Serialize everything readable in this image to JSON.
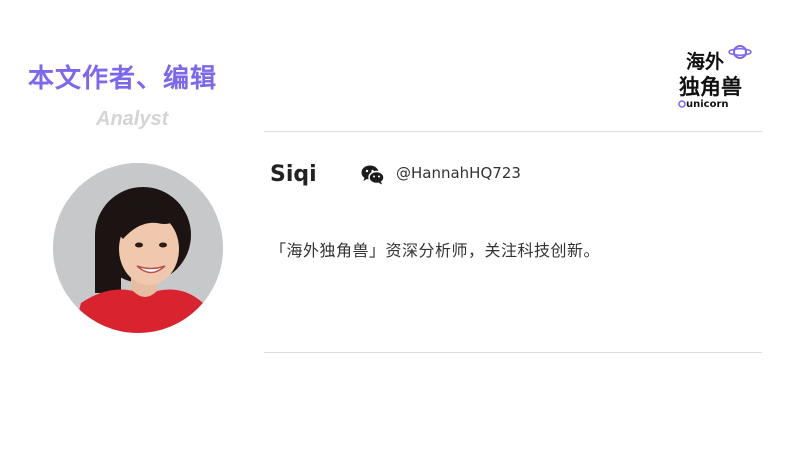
{
  "header": {
    "title": "本文作者、编辑",
    "subtitle": "Analyst"
  },
  "logo": {
    "icon": "haiwai-unicorn-logo",
    "line1": "海外",
    "line2": "独角兽",
    "wordmark": "unicorn"
  },
  "author": {
    "name": "Siqi",
    "social_icon": "wechat-icon",
    "wechat_handle": "@HannahHQ723",
    "bio": "「海外独角兽」资深分析师，关注科技创新。"
  },
  "colors": {
    "accent": "#7b68ee",
    "subtitle": "#d4d4d4",
    "rule": "#dcdcdc",
    "avatar_shirt": "#d9232e"
  }
}
